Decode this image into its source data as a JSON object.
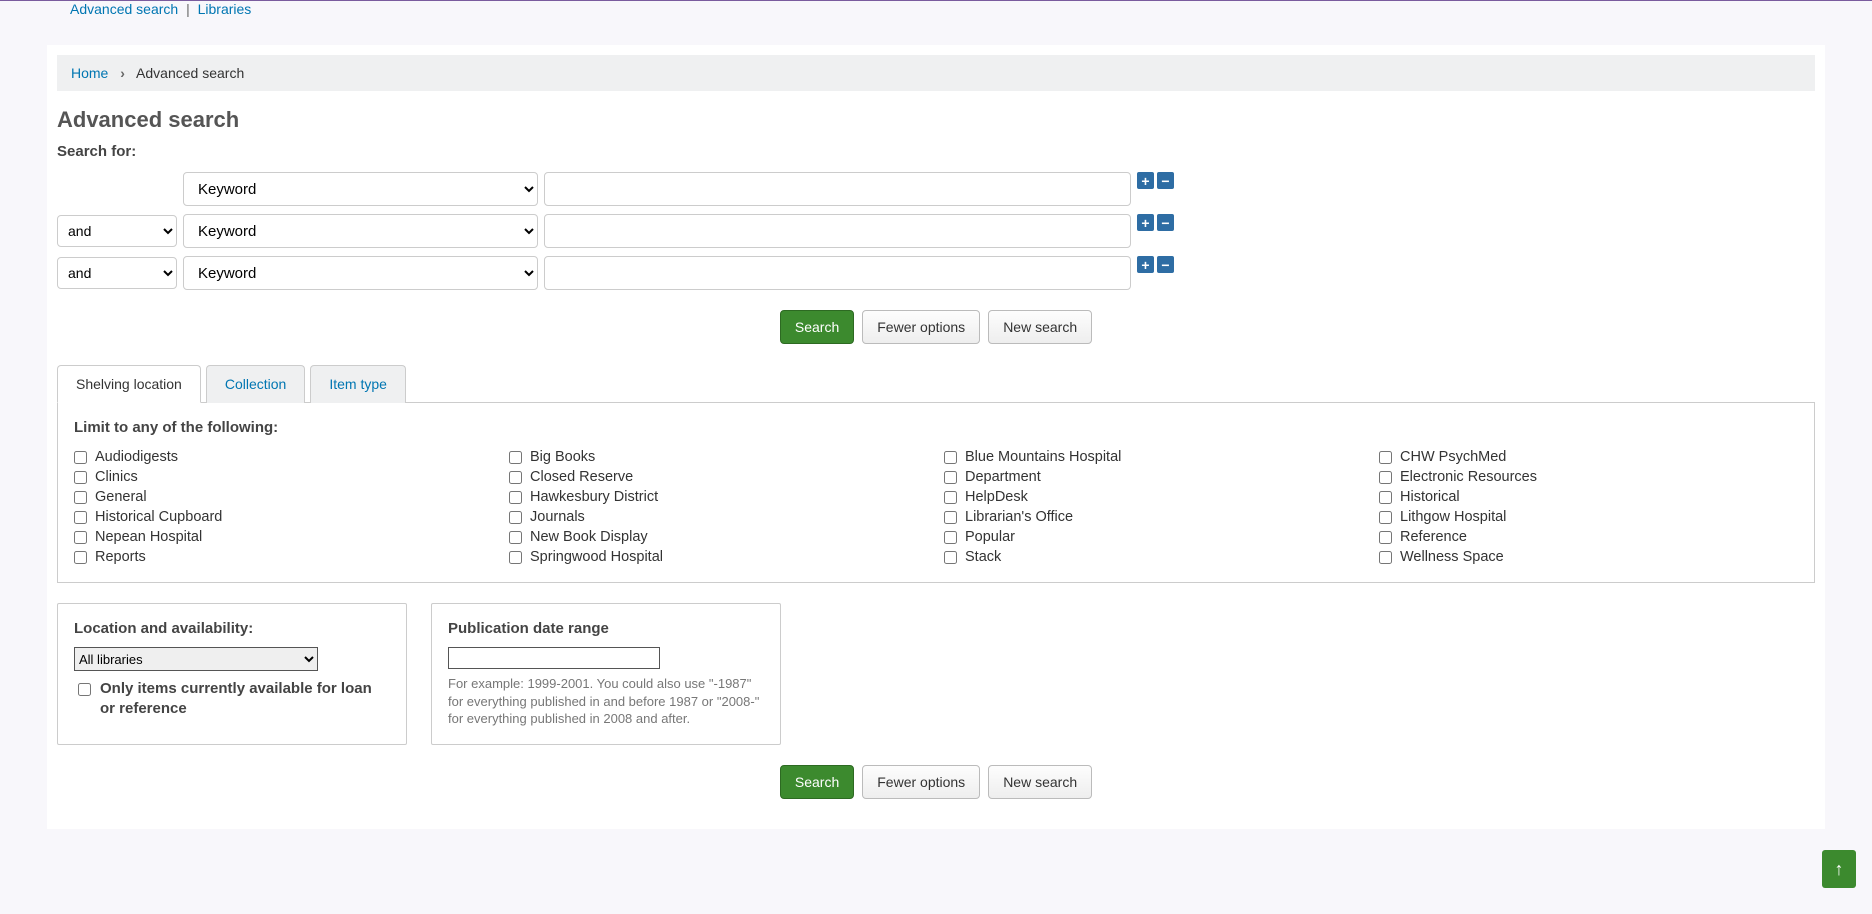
{
  "topNav": {
    "advanced_search": "Advanced search",
    "libraries": "Libraries"
  },
  "breadcrumb": {
    "home": "Home",
    "current": "Advanced search"
  },
  "page_title": "Advanced search",
  "search_for_label": "Search for:",
  "boolean_options": [
    "and"
  ],
  "field_options": [
    "Keyword"
  ],
  "search_rows": [
    {
      "bool": "",
      "field": "Keyword",
      "term": ""
    },
    {
      "bool": "and",
      "field": "Keyword",
      "term": ""
    },
    {
      "bool": "and",
      "field": "Keyword",
      "term": ""
    }
  ],
  "buttons": {
    "search": "Search",
    "fewer": "Fewer options",
    "new_search": "New search"
  },
  "tabs": {
    "shelving": "Shelving location",
    "collection": "Collection",
    "item_type": "Item type"
  },
  "limit_heading": "Limit to any of the following:",
  "shelving_locations": [
    "Audiodigests",
    "Big Books",
    "Blue Mountains Hospital",
    "CHW PsychMed",
    "Clinics",
    "Closed Reserve",
    "Department",
    "Electronic Resources",
    "General",
    "Hawkesbury District",
    "HelpDesk",
    "Historical",
    "Historical Cupboard",
    "Journals",
    "Librarian's Office",
    "Lithgow Hospital",
    "Nepean Hospital",
    "New Book Display",
    "Popular",
    "Reference",
    "Reports",
    "Springwood Hospital",
    "Stack",
    "Wellness Space"
  ],
  "location": {
    "legend": "Location and availability:",
    "library_select": "All libraries",
    "availability_label": "Only items currently available for loan or reference"
  },
  "pubdate": {
    "legend": "Publication date range",
    "hint": "For example: 1999-2001. You could also use \"-1987\" for everything published in and before 1987 or \"2008-\" for everything published in 2008 and after."
  }
}
